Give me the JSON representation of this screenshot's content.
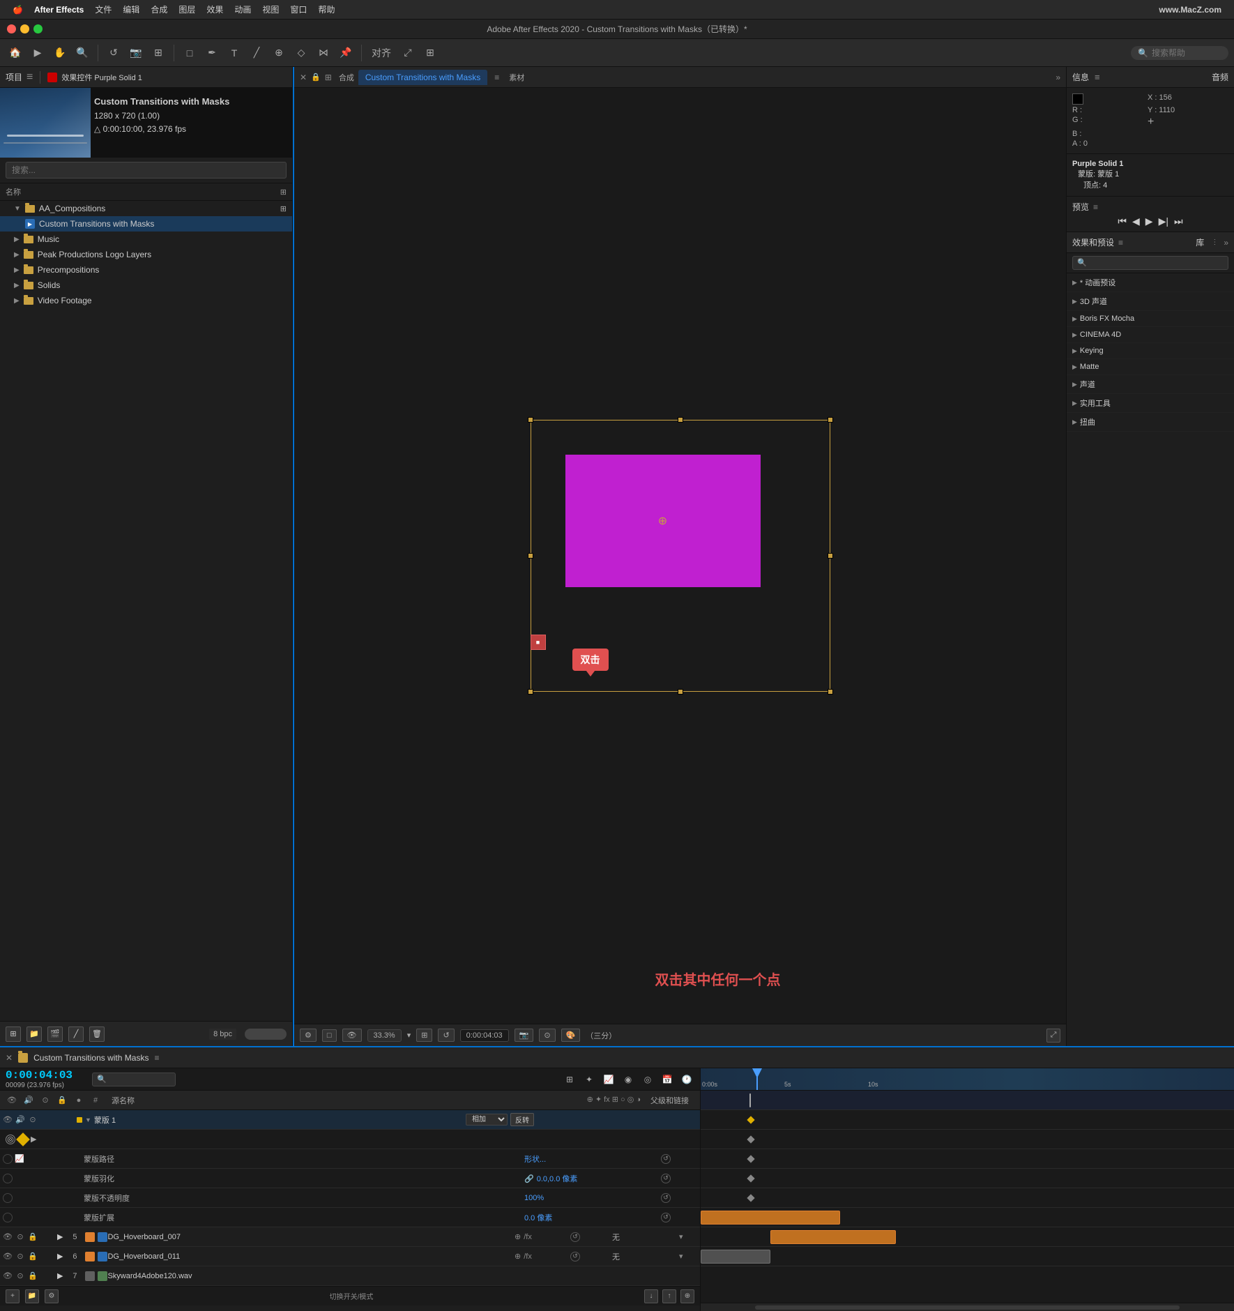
{
  "menubar": {
    "apple": "🍎",
    "appName": "After Effects",
    "menus": [
      "文件",
      "编辑",
      "合成",
      "图层",
      "效果",
      "动画",
      "视图",
      "窗口",
      "帮助"
    ],
    "watermark": "www.MacZ.com"
  },
  "titlebar": {
    "title": "Adobe After Effects 2020 - Custom Transitions with Masks（已转换）*"
  },
  "toolbar": {
    "searchPlaceholder": "搜索帮助",
    "alignLabel": "对齐"
  },
  "leftPanel": {
    "header": "项目",
    "effectsLabel": "效果控件 Purple Solid 1",
    "thumbnail": {
      "name": "Custom Transitions with Masks",
      "resolution": "1280 x 720 (1.00)",
      "duration": "△ 0:00:10:00, 23.976 fps"
    },
    "searchPlaceholder": "搜索...",
    "colHeader": "名称",
    "tree": [
      {
        "id": "aa_comp",
        "type": "folder",
        "label": "AA_Compositions",
        "indent": 0,
        "expanded": true
      },
      {
        "id": "custom_trans",
        "type": "comp",
        "label": "Custom Transitions with Masks",
        "indent": 1,
        "selected": true
      },
      {
        "id": "music",
        "type": "folder",
        "label": "Music",
        "indent": 0
      },
      {
        "id": "peak_prod",
        "type": "folder",
        "label": "Peak Productions Logo Layers",
        "indent": 0
      },
      {
        "id": "precomps",
        "type": "folder",
        "label": "Precompositions",
        "indent": 0
      },
      {
        "id": "solids",
        "type": "folder",
        "label": "Solids",
        "indent": 0
      },
      {
        "id": "video_footage",
        "type": "folder",
        "label": "Video Footage",
        "indent": 0
      }
    ],
    "bitDepth": "8 bpc"
  },
  "centerPanel": {
    "compLabel": "合成",
    "compTitle": "Custom Transitions with Masks",
    "tabLabel": "Custom Transitions with Masks",
    "materialsLabel": "素材",
    "zoom": "33.3%",
    "timecode": "0:00:04:03",
    "tooltip": "双击",
    "annotationText": "双击其中任何一个点"
  },
  "rightPanel": {
    "infoLabel": "信息",
    "audioLabel": "音频",
    "colorInfo": {
      "R": "R :",
      "G": "G :",
      "B": "B :",
      "A": "A : 0",
      "rVal": "",
      "gVal": "",
      "bVal": "",
      "X": "X : 156",
      "Y": "Y : 1110"
    },
    "solidInfo": {
      "name": "Purple Solid 1",
      "maskLabel": "蒙版: 蒙版 1",
      "vertexLabel": "顶点: 4"
    },
    "previewLabel": "预览",
    "effectsLabel": "效果和预设",
    "libraryLabel": "库",
    "effectsItems": [
      "* 动画预设",
      "3D 声道",
      "Boris FX Mocha",
      "CINEMA 4D",
      "Keying",
      "Matte",
      "声道",
      "实用工具",
      "扭曲"
    ]
  },
  "timeline": {
    "title": "Custom Transitions with Masks",
    "timecode": "0:00:04:03",
    "fpsInfo": "00099 (23.976 fps)",
    "layers": [
      {
        "id": "mask1",
        "num": "",
        "color": "#e0b000",
        "name": "蒙版 1",
        "blend": "相加",
        "expanded": true,
        "indent": 1,
        "type": "mask"
      }
    ],
    "maskProps": [
      {
        "label": "蒙版路径",
        "value": "形状...",
        "icon": "cycle"
      },
      {
        "label": "蒙版羽化",
        "value": "0.0,0.0 像素",
        "icon": "link"
      },
      {
        "label": "蒙版不透明度",
        "value": "100%",
        "icon": ""
      },
      {
        "label": "蒙版扩展",
        "value": "0.0 像素",
        "icon": ""
      }
    ],
    "videoLayers": [
      {
        "num": "5",
        "color": "#e08030",
        "name": "DG_Hoverboard_007",
        "visible": true
      },
      {
        "num": "6",
        "color": "#e08030",
        "name": "DG_Hoverboard_011",
        "visible": true
      },
      {
        "num": "7",
        "color": "#606060",
        "name": "Skyward4Adobe120.wav",
        "visible": true
      }
    ],
    "bottomLabel": "切换开关/模式"
  }
}
